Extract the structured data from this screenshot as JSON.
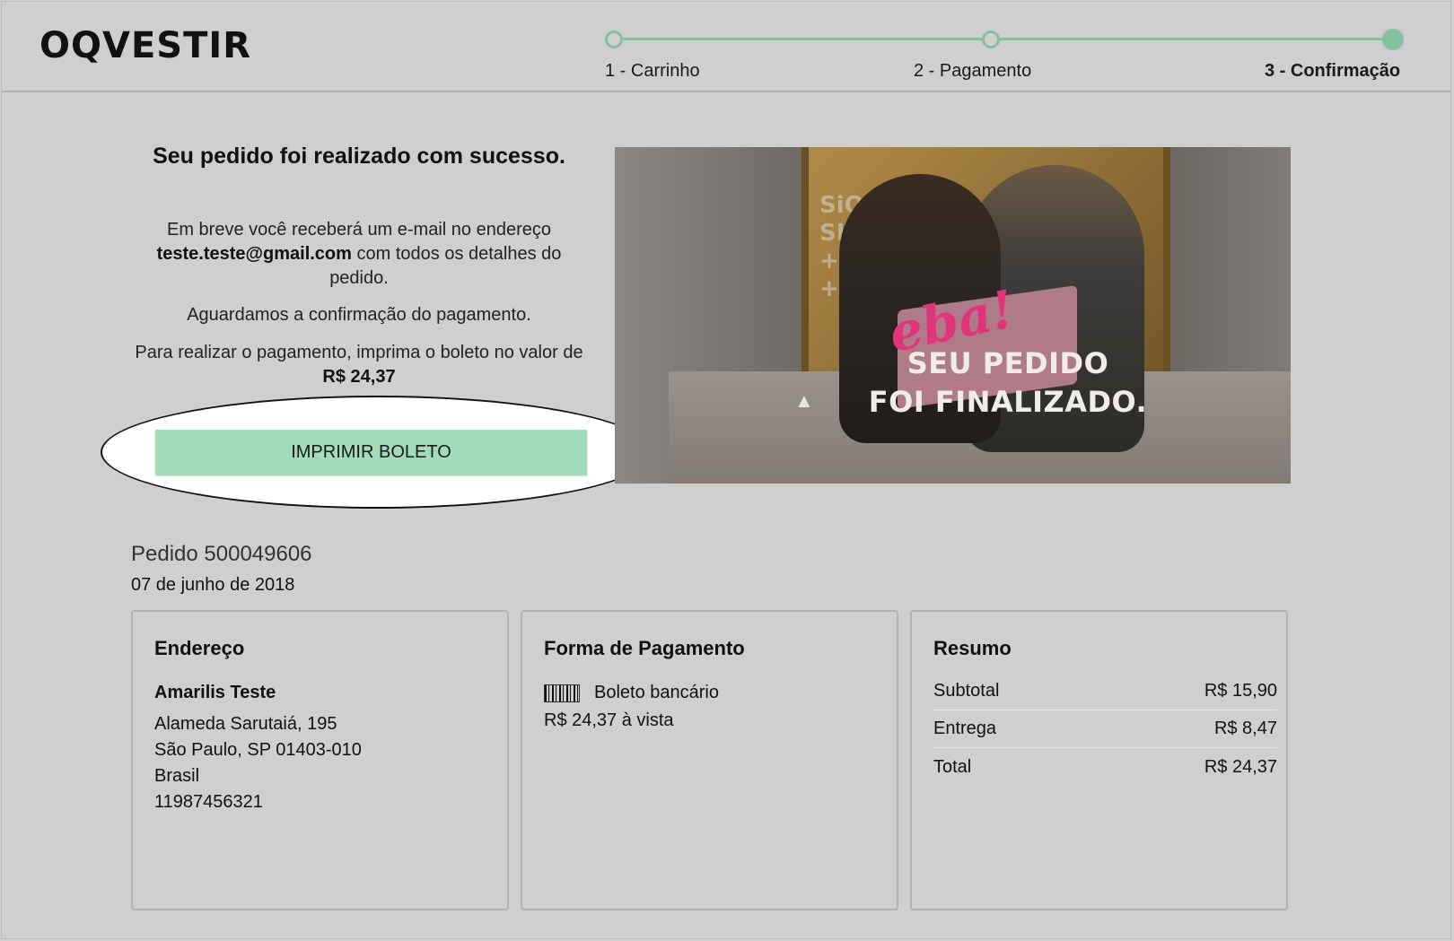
{
  "header": {
    "logo": "OQVESTIR",
    "steps": [
      {
        "label": "1 - Carrinho"
      },
      {
        "label": "2 - Pagamento"
      },
      {
        "label": "3 - Confirmação"
      }
    ],
    "accent_color": "#86c0a3"
  },
  "confirmation": {
    "title": "Seu pedido foi realizado com sucesso.",
    "email_prefix": "Em breve você receberá um e-mail no endereço ",
    "email": "teste.teste@gmail.com",
    "email_suffix": " com todos os detalhes do pedido.",
    "awaiting": "Aguardamos a confirmação do pagamento.",
    "payment_instruction": "Para realizar o pagamento, imprima o boleto no valor de ",
    "payment_value": "R$ 24,37",
    "print_button": "IMPRIMIR BOLETO",
    "button_color": "#a3dcbb"
  },
  "banner": {
    "art_lines": [
      "SiO4 +",
      "SILIC",
      "+ BI",
      "+ ZI"
    ],
    "script_text": "eba!",
    "title_line1": "SEU PEDIDO",
    "title_line2": "FOI FINALIZADO."
  },
  "order": {
    "number": "Pedido 500049606",
    "date": "07 de junho de 2018"
  },
  "address": {
    "title": "Endereço",
    "name": "Amarilis Teste",
    "lines": [
      "Alameda Sarutaiá, 195",
      "São Paulo, SP 01403-010",
      "Brasil",
      "11987456321"
    ]
  },
  "payment": {
    "title": "Forma de Pagamento",
    "icon": "barcode-icon",
    "method": "Boleto bancário",
    "amount": "R$ 24,37 à vista"
  },
  "summary": {
    "title": "Resumo",
    "rows": [
      {
        "label": "Subtotal",
        "value": "R$ 15,90"
      },
      {
        "label": "Entrega",
        "value": "R$ 8,47"
      },
      {
        "label": "Total",
        "value": "R$ 24,37"
      }
    ]
  }
}
